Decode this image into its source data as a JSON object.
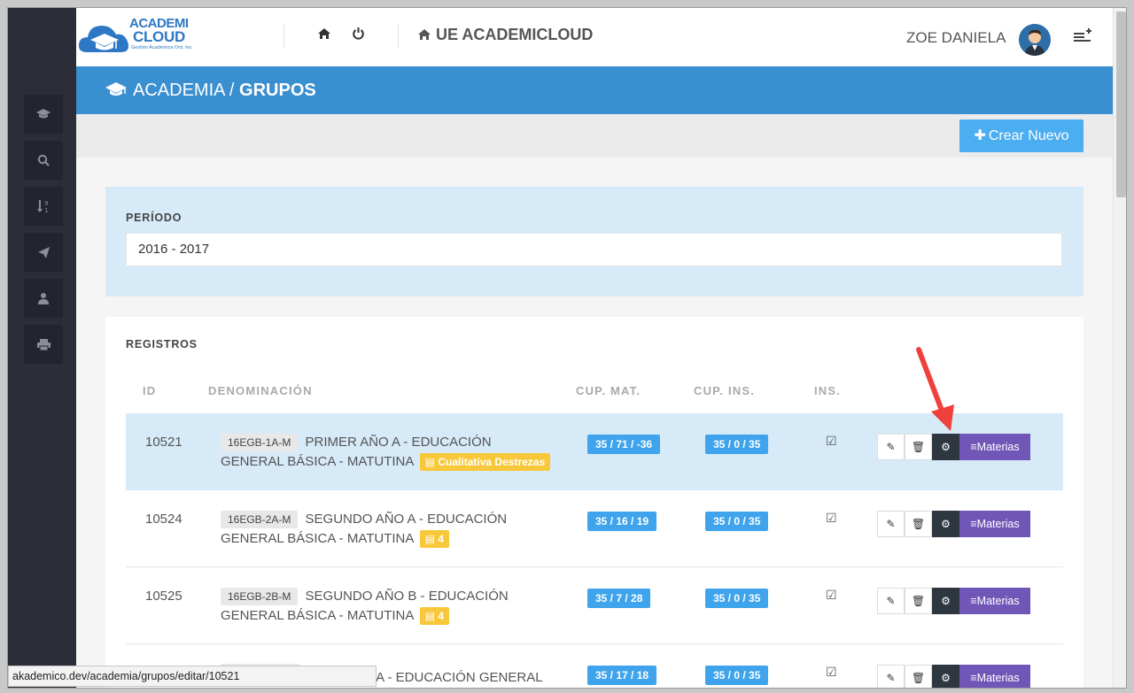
{
  "app": {
    "logo_line1": "ACADEMI",
    "logo_line2": "CLOUD",
    "logo_tag": "Gestión Académica Ord. Inc",
    "brand": "UE ACADEMICLOUD",
    "user": "ZOE DANIELA"
  },
  "sidebar": {
    "items": [
      {
        "icon": "graduation-cap-icon"
      },
      {
        "icon": "search-icon"
      },
      {
        "icon": "sort-numeric-icon"
      },
      {
        "icon": "paper-plane-icon"
      },
      {
        "icon": "user-icon"
      },
      {
        "icon": "print-icon"
      }
    ]
  },
  "header": {
    "section": "ACADEMIA /",
    "page": "GRUPOS"
  },
  "toolbar": {
    "new_label": "Crear Nuevo"
  },
  "period": {
    "label": "PERÍODO",
    "value": "2016 - 2017"
  },
  "records": {
    "label": "REGISTROS",
    "columns": [
      "ID",
      "DENOMINACIÓN",
      "CUP. MAT.",
      "CUP. INS.",
      "INS."
    ],
    "rows": [
      {
        "id": "10521",
        "code": "16EGB-1A-M",
        "name": "PRIMER AÑO A - EDUCACIÓN GENERAL BÁSICA - MATUTINA",
        "tag": "Cualitativa Destrezas",
        "cup_mat": "35 / 71 / -36",
        "cup_ins": "35 / 0 / 35",
        "actions_label": "Materias"
      },
      {
        "id": "10524",
        "code": "16EGB-2A-M",
        "name": "SEGUNDO AÑO A - EDUCACIÓN GENERAL BÁSICA - MATUTINA",
        "tag": "4",
        "cup_mat": "35 / 16 / 19",
        "cup_ins": "35 / 0 / 35",
        "actions_label": "Materias"
      },
      {
        "id": "10525",
        "code": "16EGB-2B-M",
        "name": "SEGUNDO AÑO B - EDUCACIÓN GENERAL BÁSICA - MATUTINA",
        "tag": "4",
        "cup_mat": "35 / 7 / 28",
        "cup_ins": "35 / 0 / 35",
        "actions_label": "Materias"
      },
      {
        "id": "",
        "code": "",
        "name": "A - EDUCACIÓN GENERAL",
        "tag": "",
        "cup_mat": "35 / 17 / 18",
        "cup_ins": "35 / 0 / 35",
        "actions_label": "Materias"
      }
    ]
  },
  "status_bar": {
    "url": "akademico.dev/academia/grupos/editar/10521"
  },
  "colors": {
    "primary": "#3a8fd0",
    "pill": "#3fa4ec",
    "materias": "#7057b7",
    "tag": "#f9c83a",
    "arrow": "#f0403c"
  }
}
